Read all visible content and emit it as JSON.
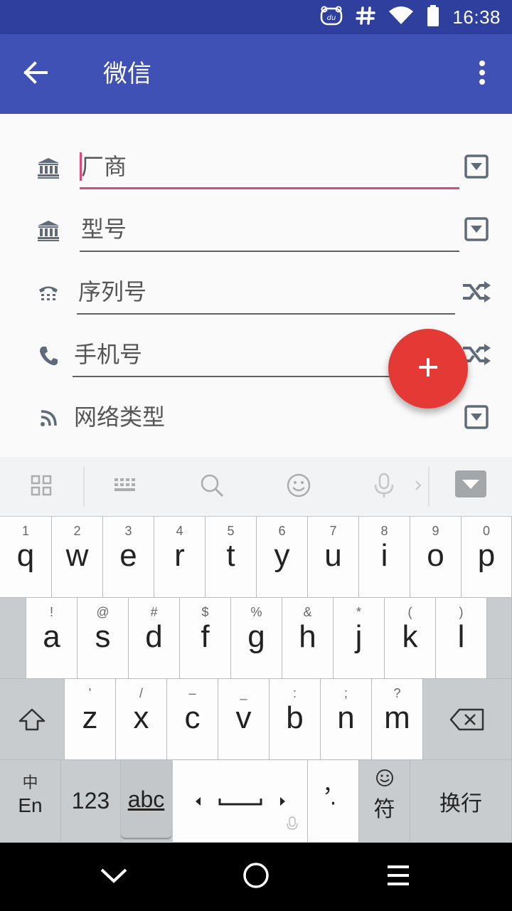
{
  "status_bar": {
    "time": "16:38"
  },
  "app_bar": {
    "title": "微信"
  },
  "form": {
    "fields": [
      {
        "label": "厂商"
      },
      {
        "label": "型号"
      },
      {
        "label": "序列号"
      },
      {
        "label": "手机号"
      },
      {
        "label": "网络类型"
      }
    ]
  },
  "fab": {
    "label": "+"
  },
  "keyboard": {
    "row1": [
      {
        "num": "1",
        "letter": "q"
      },
      {
        "num": "2",
        "letter": "w"
      },
      {
        "num": "3",
        "letter": "e"
      },
      {
        "num": "4",
        "letter": "r"
      },
      {
        "num": "5",
        "letter": "t"
      },
      {
        "num": "6",
        "letter": "y"
      },
      {
        "num": "7",
        "letter": "u"
      },
      {
        "num": "8",
        "letter": "i"
      },
      {
        "num": "9",
        "letter": "o"
      },
      {
        "num": "0",
        "letter": "p"
      }
    ],
    "row2": [
      {
        "sym": "!",
        "letter": "a"
      },
      {
        "sym": "@",
        "letter": "s"
      },
      {
        "sym": "#",
        "letter": "d"
      },
      {
        "sym": "$",
        "letter": "f"
      },
      {
        "sym": "%",
        "letter": "g"
      },
      {
        "sym": "&",
        "letter": "h"
      },
      {
        "sym": "*",
        "letter": "j"
      },
      {
        "sym": "(",
        "letter": "k"
      },
      {
        "sym": ")",
        "letter": "l"
      }
    ],
    "row3": [
      {
        "sym": "'",
        "letter": "z"
      },
      {
        "sym": "/",
        "letter": "x"
      },
      {
        "sym": "–",
        "letter": "c"
      },
      {
        "sym": "_",
        "letter": "v"
      },
      {
        "sym": ":",
        "letter": "b"
      },
      {
        "sym": ";",
        "letter": "n"
      },
      {
        "sym": "?",
        "letter": "m"
      }
    ],
    "lang_top": "中",
    "lang_bottom": "En",
    "num_key": "123",
    "abc_key": "abc",
    "punct_top": "，",
    "punct_bottom": "·",
    "symbol_key": "符",
    "enter_key": "换行"
  }
}
